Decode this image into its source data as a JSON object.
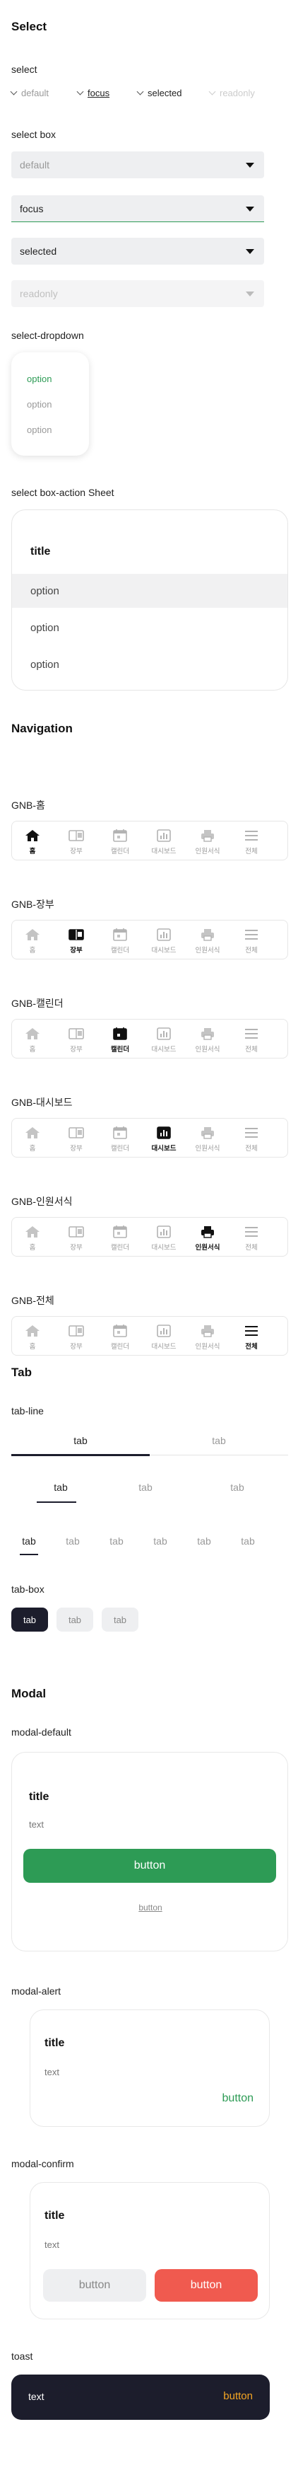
{
  "select_section": {
    "heading": "Select",
    "select_label": "select",
    "inline_selects": [
      "default",
      "focus",
      "selected",
      "readonly"
    ],
    "selectbox_label": "select box",
    "boxes": [
      "default",
      "focus",
      "selected",
      "readonly"
    ],
    "dropdown_label": "select-dropdown",
    "dropdown_options": [
      "option",
      "option",
      "option"
    ],
    "sheet_label": "select box-action Sheet",
    "sheet_title": "title",
    "sheet_options": [
      "option",
      "option",
      "option"
    ]
  },
  "navigation": {
    "heading": "Navigation",
    "menu_items": [
      "홈",
      "장부",
      "캘린더",
      "대시보드",
      "인원서식",
      "전체"
    ],
    "icons": [
      "home-icon",
      "ledger-icon",
      "calendar-icon",
      "dashboard-icon",
      "printer-icon",
      "menu-icon"
    ],
    "variants": [
      {
        "label": "GNB-홈"
      },
      {
        "label": "GNB-장부"
      },
      {
        "label": "GNB-캘린더"
      },
      {
        "label": "GNB-대시보드"
      },
      {
        "label": "GNB-인원서식"
      },
      {
        "label": "GNB-전체"
      }
    ]
  },
  "tab_section": {
    "heading": "Tab",
    "line_label": "tab-line",
    "line2": [
      "tab",
      "tab"
    ],
    "line3": [
      "tab",
      "tab",
      "tab"
    ],
    "line6": [
      "tab",
      "tab",
      "tab",
      "tab",
      "tab",
      "tab"
    ],
    "box_label": "tab-box",
    "box_tabs": [
      "tab",
      "tab",
      "tab"
    ]
  },
  "modal_section": {
    "heading": "Modal",
    "default_label": "modal-default",
    "default_title": "title",
    "default_text": "text",
    "default_button": "button",
    "default_link": "button",
    "alert_label": "modal-alert",
    "alert_title": "title",
    "alert_text": "text",
    "alert_button": "button",
    "confirm_label": "modal-confirm",
    "confirm_title": "title",
    "confirm_text": "text",
    "confirm_cancel": "button",
    "confirm_ok": "button",
    "toast_label": "toast",
    "toast_text": "text",
    "toast_button": "button"
  },
  "colors": {
    "green": "#2d9b55",
    "navy": "#1c1d2c",
    "coral": "#f05a4f",
    "toast_accent": "#f5a623"
  }
}
